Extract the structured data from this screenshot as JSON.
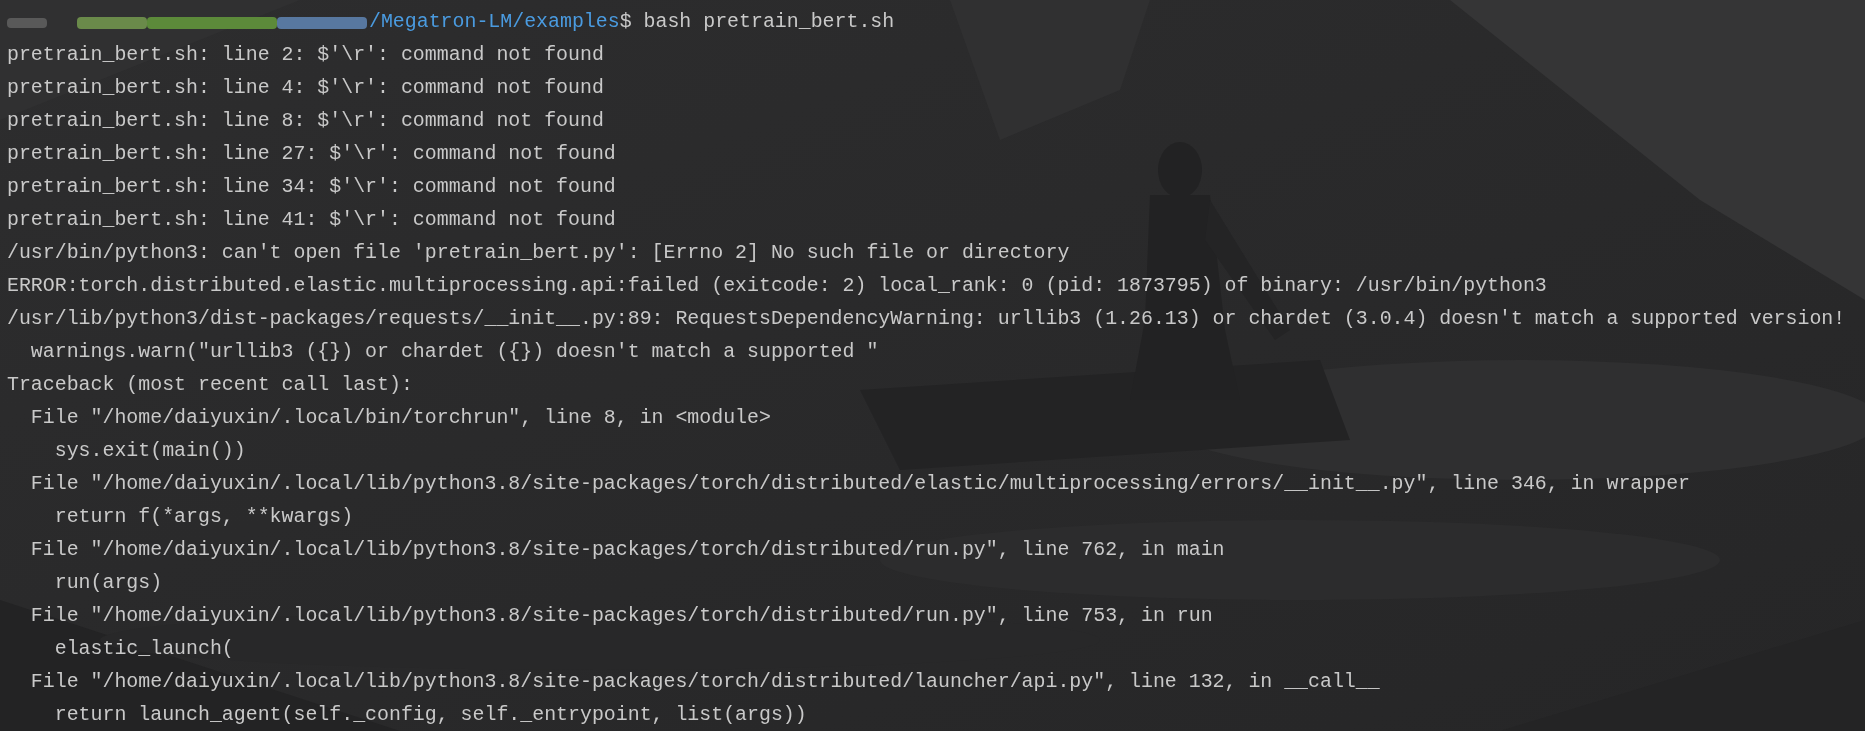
{
  "prompt": {
    "path": "/Megatron-LM/examples",
    "command": "$ bash pretrain_bert.sh"
  },
  "lines": [
    "pretrain_bert.sh: line 2: $'\\r': command not found",
    "pretrain_bert.sh: line 4: $'\\r': command not found",
    "pretrain_bert.sh: line 8: $'\\r': command not found",
    "pretrain_bert.sh: line 27: $'\\r': command not found",
    "pretrain_bert.sh: line 34: $'\\r': command not found",
    "pretrain_bert.sh: line 41: $'\\r': command not found",
    "/usr/bin/python3: can't open file 'pretrain_bert.py': [Errno 2] No such file or directory",
    "ERROR:torch.distributed.elastic.multiprocessing.api:failed (exitcode: 2) local_rank: 0 (pid: 1873795) of binary: /usr/bin/python3",
    "/usr/lib/python3/dist-packages/requests/__init__.py:89: RequestsDependencyWarning: urllib3 (1.26.13) or chardet (3.0.4) doesn't match a supported version!",
    "  warnings.warn(\"urllib3 ({}) or chardet ({}) doesn't match a supported \"",
    "Traceback (most recent call last):",
    "  File \"/home/daiyuxin/.local/bin/torchrun\", line 8, in <module>",
    "    sys.exit(main())",
    "  File \"/home/daiyuxin/.local/lib/python3.8/site-packages/torch/distributed/elastic/multiprocessing/errors/__init__.py\", line 346, in wrapper",
    "    return f(*args, **kwargs)",
    "  File \"/home/daiyuxin/.local/lib/python3.8/site-packages/torch/distributed/run.py\", line 762, in main",
    "    run(args)",
    "  File \"/home/daiyuxin/.local/lib/python3.8/site-packages/torch/distributed/run.py\", line 753, in run",
    "    elastic_launch(",
    "  File \"/home/daiyuxin/.local/lib/python3.8/site-packages/torch/distributed/launcher/api.py\", line 132, in __call__",
    "    return launch_agent(self._config, self._entrypoint, list(args))"
  ]
}
